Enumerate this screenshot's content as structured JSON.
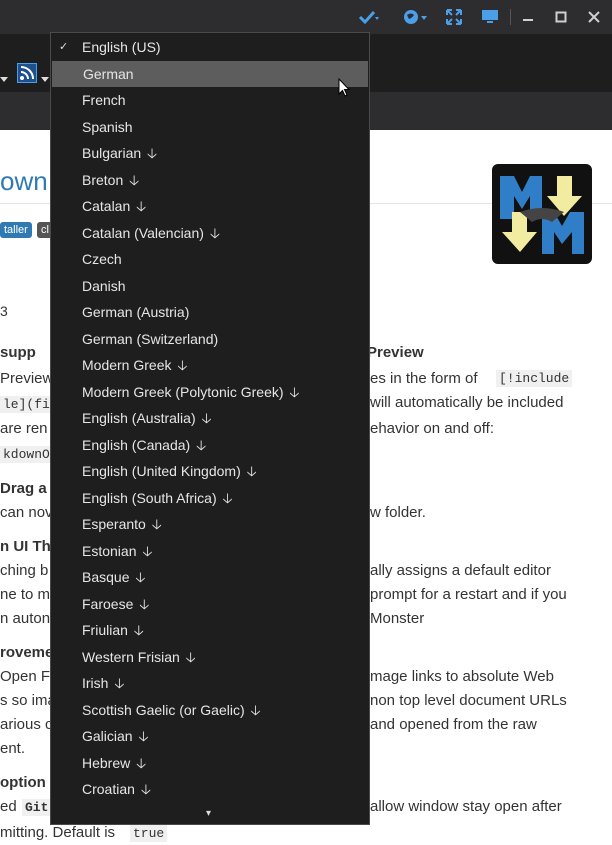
{
  "titlebar": {
    "icons": [
      "check-icon",
      "globe-icon",
      "fullscreen-icon",
      "monitor-icon"
    ],
    "window_controls": {
      "minimize": "▁",
      "maximize": "☐",
      "close": "✕"
    },
    "accent": "#4a9fe8"
  },
  "toolbar": {
    "rss_icon": "rss-icon"
  },
  "preview": {
    "title_fragment": "own",
    "badges": [
      "taller",
      "cl"
    ],
    "version_fragment": "3",
    "lines": [
      {
        "left": "supp",
        "right": "Preview",
        "bold": true
      },
      {
        "left": "Preview",
        "right": "es in the form of"
      },
      {
        "left": "le](fi",
        "right": "will automatically be included"
      },
      {
        "left": "are ren",
        "right": "ehavior on and off:"
      },
      {
        "left": "kdownOp",
        "right": ""
      },
      {
        "left": "Drag a",
        "right": "",
        "bold": true
      },
      {
        "left": "can nov",
        "right": "w folder."
      },
      {
        "left": "n UI Th",
        "right": "",
        "bold": true
      },
      {
        "left": "ching b",
        "right": "ally assigns a default editor"
      },
      {
        "left": "ne to m",
        "right": "prompt for a restart and if you"
      },
      {
        "left": "n auton",
        "right": "Monster"
      },
      {
        "left": "roveme",
        "right": "",
        "bold": true
      },
      {
        "left": "Open F",
        "right": "mage links to absolute Web"
      },
      {
        "left": "s so ima",
        "right": "non top level document URLs"
      },
      {
        "left": "arious c",
        "right": "and opened from the raw"
      },
      {
        "left": "ent.",
        "right": ""
      },
      {
        "left": "option",
        "right": "",
        "bold": true
      },
      {
        "left": "ed",
        "right": "allow window stay open after"
      },
      {
        "left": "mitting. Default is",
        "right": ""
      }
    ],
    "code_include": "[!include",
    "code_git": "Git",
    "code_true": "true"
  },
  "menu": {
    "items": [
      {
        "label": "English (US)",
        "checked": true,
        "download": false
      },
      {
        "label": "German",
        "checked": false,
        "download": false,
        "hover": true
      },
      {
        "label": "French",
        "checked": false,
        "download": false
      },
      {
        "label": "Spanish",
        "checked": false,
        "download": false
      },
      {
        "label": "Bulgarian",
        "checked": false,
        "download": true
      },
      {
        "label": "Breton",
        "checked": false,
        "download": true
      },
      {
        "label": "Catalan",
        "checked": false,
        "download": true
      },
      {
        "label": "Catalan (Valencian)",
        "checked": false,
        "download": true
      },
      {
        "label": "Czech",
        "checked": false,
        "download": false
      },
      {
        "label": "Danish",
        "checked": false,
        "download": false
      },
      {
        "label": "German (Austria)",
        "checked": false,
        "download": false
      },
      {
        "label": "German (Switzerland)",
        "checked": false,
        "download": false
      },
      {
        "label": "Modern Greek",
        "checked": false,
        "download": true
      },
      {
        "label": "Modern Greek (Polytonic Greek)",
        "checked": false,
        "download": true
      },
      {
        "label": "English (Australia)",
        "checked": false,
        "download": true
      },
      {
        "label": "English (Canada)",
        "checked": false,
        "download": true
      },
      {
        "label": "English (United Kingdom)",
        "checked": false,
        "download": true
      },
      {
        "label": "English (South Africa)",
        "checked": false,
        "download": true
      },
      {
        "label": "Esperanto",
        "checked": false,
        "download": true
      },
      {
        "label": "Estonian",
        "checked": false,
        "download": true
      },
      {
        "label": "Basque",
        "checked": false,
        "download": true
      },
      {
        "label": "Faroese",
        "checked": false,
        "download": true
      },
      {
        "label": "Friulian",
        "checked": false,
        "download": true
      },
      {
        "label": "Western Frisian",
        "checked": false,
        "download": true
      },
      {
        "label": "Irish",
        "checked": false,
        "download": true
      },
      {
        "label": "Scottish Gaelic (or Gaelic)",
        "checked": false,
        "download": true
      },
      {
        "label": "Galician",
        "checked": false,
        "download": true
      },
      {
        "label": "Hebrew",
        "checked": false,
        "download": true
      },
      {
        "label": "Croatian",
        "checked": false,
        "download": true
      }
    ],
    "check_glyph": "✓",
    "download_glyph": "🡣",
    "scroll_glyph": "▾"
  }
}
